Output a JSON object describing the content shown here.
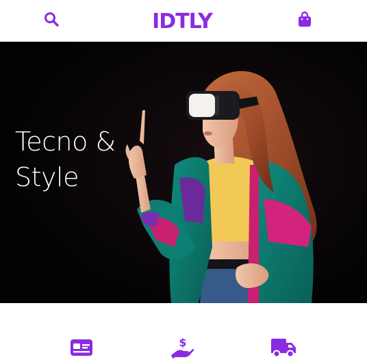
{
  "header": {
    "logo_text": "IDTLY",
    "search_icon": "search-icon",
    "bag_icon": "shopping-bag-icon"
  },
  "hero": {
    "title_line1": "Tecno &",
    "title_line2": "Style",
    "image": "woman-vr-headset-photo"
  },
  "features": [
    {
      "icon": "credit-card-icon"
    },
    {
      "icon": "hand-holding-dollar-icon"
    },
    {
      "icon": "delivery-truck-icon"
    }
  ],
  "colors": {
    "accent": "#8a2be2",
    "hero_background": "#050304",
    "hero_text": "#ffffff",
    "page_background": "#ffffff"
  }
}
